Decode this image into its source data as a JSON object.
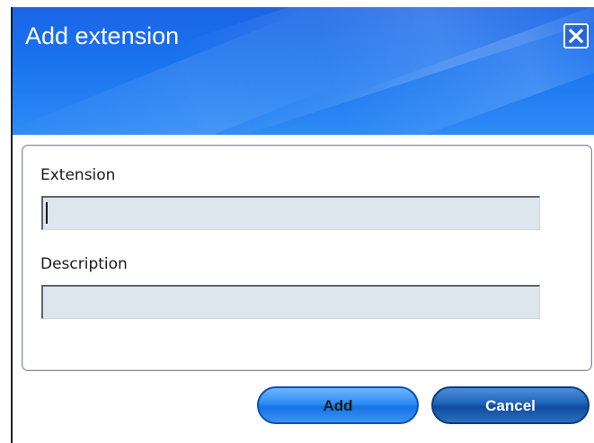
{
  "dialog": {
    "title": "Add extension",
    "close_icon": "close-x-icon"
  },
  "form": {
    "extension": {
      "label": "Extension",
      "value": "",
      "placeholder": ""
    },
    "description": {
      "label": "Description",
      "value": "",
      "placeholder": ""
    }
  },
  "buttons": {
    "add_label": "Add",
    "cancel_label": "Cancel"
  },
  "colors": {
    "titlebar_blue": "#1a6ee8",
    "field_background": "#dce6ee",
    "add_button": "#2d8cf5",
    "cancel_button": "#1e63b8"
  }
}
